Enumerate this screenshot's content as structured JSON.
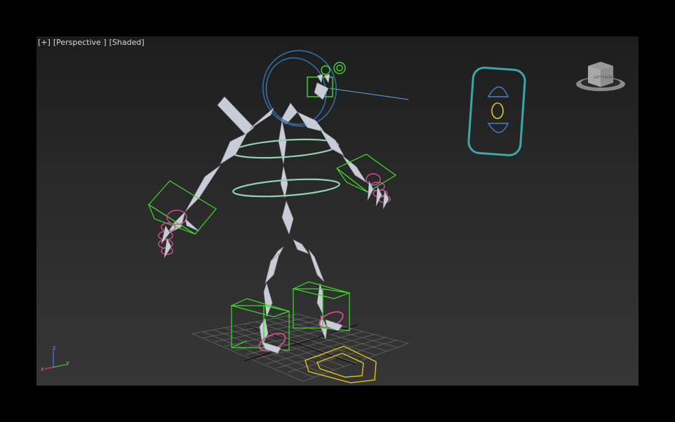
{
  "viewport": {
    "label_plus": "[+]",
    "label_view": "[Perspective ]",
    "label_shading": "[Shaded]"
  },
  "viewcube": {
    "face_left": "LEFT",
    "face_front": "FRONT"
  },
  "axis": {
    "z": "z",
    "x": "x",
    "y": "y"
  },
  "colors": {
    "bone": "#c8ccd6",
    "ik_box": "#3ddc28",
    "spine_ring": "#8fd3b0",
    "finger_ctrl": "#d0508f",
    "head_ctrl": "#2f6fa8",
    "root_ctrl": "#e3c21c",
    "panel_ctrl": "#3aa8a8",
    "grid": "#6a6a6a"
  }
}
